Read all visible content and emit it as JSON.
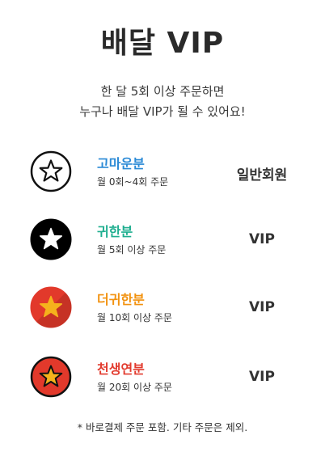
{
  "header": {
    "title": "배달 VIP",
    "subtitle_line1": "한 달 5회 이상 주문하면",
    "subtitle_line2": "누구나 배달 VIP가 될 수 있어요!"
  },
  "tiers": [
    {
      "name": "고마운분",
      "description": "월 0회~4회 주문",
      "rank": "일반회원",
      "name_color": "#2b8ad6",
      "badge": {
        "icon": "star-outline-icon",
        "circle_color": "#ffffff",
        "ring_color": "#111111",
        "star_fill": "#ffffff",
        "star_stroke": "#111111"
      }
    },
    {
      "name": "귀한분",
      "description": "월 5회 이상 주문",
      "rank": "VIP",
      "name_color": "#1fae8f",
      "badge": {
        "icon": "star-white-on-black-icon",
        "circle_color": "#000000",
        "ring_color": "#000000",
        "star_fill": "#ffffff",
        "star_stroke": "#ffffff"
      }
    },
    {
      "name": "더귀한분",
      "description": "월 10회 이상 주문",
      "rank": "VIP",
      "name_color": "#f2920f",
      "badge": {
        "icon": "star-gold-on-red-icon",
        "circle_color": "#e2392b",
        "ring_color": "#e2392b",
        "star_fill": "#f5b21c",
        "star_stroke": "#f5b21c"
      }
    },
    {
      "name": "천생연분",
      "description": "월 20회 이상 주문",
      "rank": "VIP",
      "name_color": "#e23b2e",
      "badge": {
        "icon": "star-gold-outlined-on-red-icon",
        "circle_color": "#e2392b",
        "ring_color": "#111111",
        "star_fill": "#f5b21c",
        "star_stroke": "#111111"
      }
    }
  ],
  "footer": {
    "note": "* 바로결제 주문 포함. 기타 주문은 제외."
  }
}
